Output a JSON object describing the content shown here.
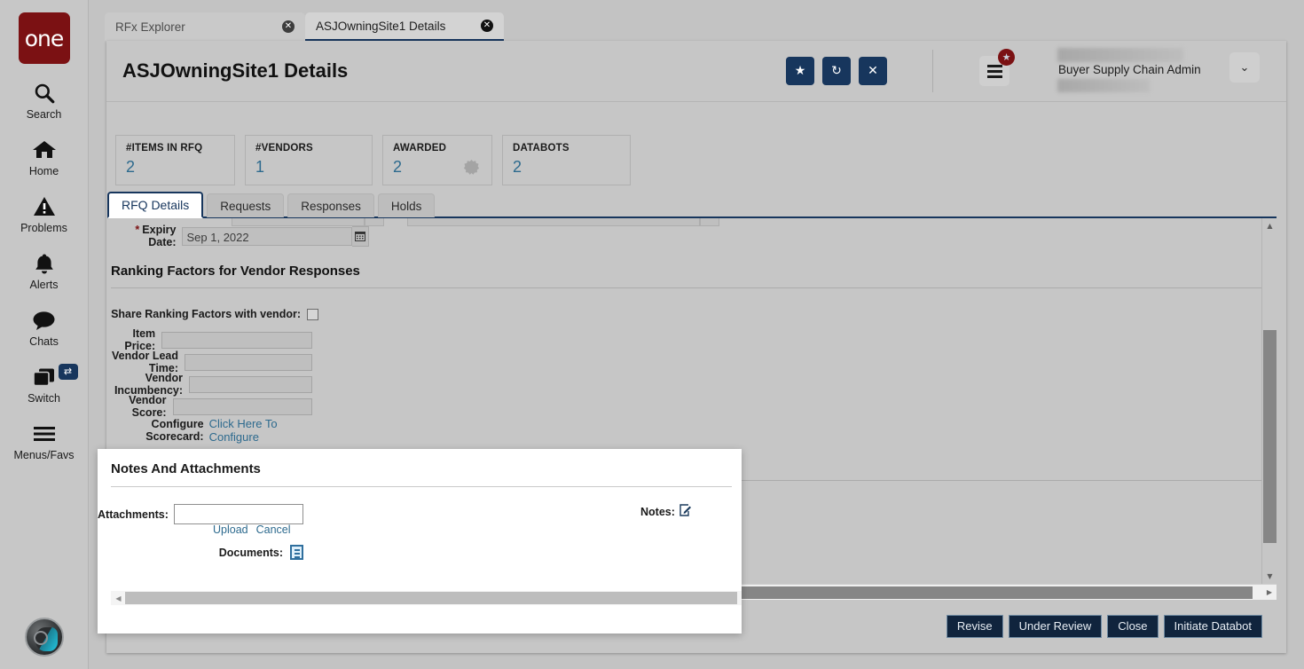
{
  "brand": {
    "logo_text": "one",
    "accent": "#7b1113",
    "primary": "#17365d"
  },
  "sidebar": {
    "items": [
      {
        "label": "Search",
        "icon": "search-icon"
      },
      {
        "label": "Home",
        "icon": "home-icon"
      },
      {
        "label": "Problems",
        "icon": "warning-triangle-icon"
      },
      {
        "label": "Alerts",
        "icon": "bell-icon"
      },
      {
        "label": "Chats",
        "icon": "chat-bubble-icon"
      },
      {
        "label": "Switch",
        "icon": "windows-stack-icon",
        "badge_icon": "swap-arrows-icon"
      },
      {
        "label": "Menus/Favs",
        "icon": "hamburger-icon"
      }
    ],
    "assistant_avatar": "ai-head-avatar-icon"
  },
  "browser_tabs": [
    {
      "label": "RFx Explorer",
      "active": false,
      "close_icon": "close-circle-icon"
    },
    {
      "label": "ASJOwningSite1 Details",
      "active": true,
      "close_icon": "close-circle-icon"
    }
  ],
  "header": {
    "title": "ASJOwningSite1 Details",
    "actions": [
      {
        "name": "favorite-button",
        "icon": "star-icon",
        "glyph": "★"
      },
      {
        "name": "refresh-button",
        "icon": "refresh-icon",
        "glyph": "↻"
      },
      {
        "name": "close-button",
        "icon": "close-x-icon",
        "glyph": "✕"
      }
    ],
    "menu_badge_glyph": "★",
    "user_name": "Buyer Supply Chain Admin",
    "user_caret_glyph": "❯"
  },
  "kpis": [
    {
      "label": "#ITEMS IN RFQ",
      "value": "2",
      "badge": false
    },
    {
      "label": "#VENDORS",
      "value": "1",
      "badge": false
    },
    {
      "label": "AWARDED",
      "value": "2",
      "badge": true
    },
    {
      "label": "DATABOTS",
      "value": "2",
      "badge": false
    }
  ],
  "tabs": [
    {
      "label": "RFQ Details",
      "active": true
    },
    {
      "label": "Requests",
      "active": false
    },
    {
      "label": "Responses",
      "active": false
    },
    {
      "label": "Holds",
      "active": false
    }
  ],
  "form": {
    "expiry_label": "Expiry Date:",
    "expiry_required_marker": "*",
    "expiry_value": "Sep 1, 2022",
    "calendar_glyph": "☷",
    "section_title": "Ranking Factors for Vendor Responses",
    "share_label": "Share Ranking Factors with vendor:",
    "share_checked": false,
    "fields": [
      {
        "label": "Item Price:",
        "value": ""
      },
      {
        "label": "Vendor Lead Time:",
        "value": ""
      },
      {
        "label": "Vendor Incumbency:",
        "value": ""
      },
      {
        "label": "Vendor Score:",
        "value": ""
      }
    ],
    "scorecard_label": "Configure Scorecard:",
    "scorecard_link": "Click Here To Configure"
  },
  "modal": {
    "title": "Notes And Attachments",
    "attachments_label": "Attachments:",
    "attachments_value": "",
    "upload_link": "Upload",
    "cancel_link": "Cancel",
    "documents_label": "Documents:",
    "documents_icon": "document-file-icon",
    "notes_label": "Notes:",
    "notes_icon": "edit-pencil-icon",
    "notes_glyph": "✎"
  },
  "footer": {
    "buttons": [
      {
        "label": "Revise"
      },
      {
        "label": "Under Review"
      },
      {
        "label": "Close"
      },
      {
        "label": "Initiate Databot"
      }
    ]
  },
  "scroll": {
    "up_glyph": "▲",
    "down_glyph": "▼",
    "left_glyph": "◀",
    "right_glyph": "▶"
  }
}
